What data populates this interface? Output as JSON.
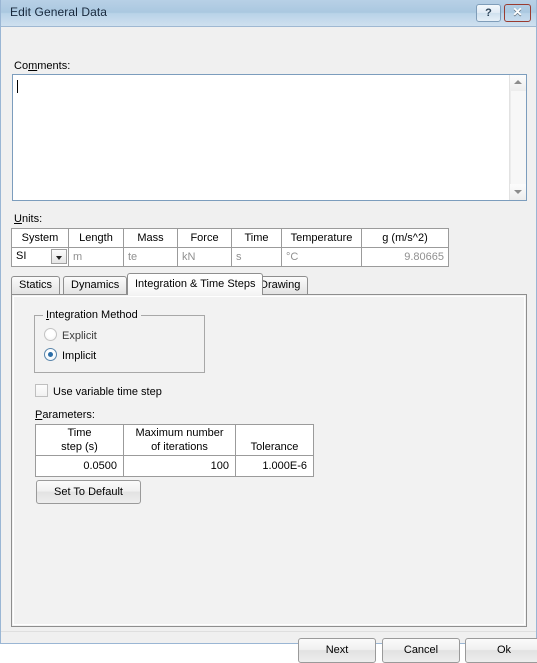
{
  "window": {
    "title": "Edit General Data",
    "help_button": "?",
    "close_button": "✕"
  },
  "comments": {
    "label": "Comments:",
    "label_prefix": "Co",
    "label_accel": "m",
    "label_suffix": "ments:",
    "value": "",
    "placeholder": "",
    "scroll_up": "▲",
    "scroll_down": "▼"
  },
  "units": {
    "label": "Units:",
    "label_accel": "U",
    "label_suffix": "nits:",
    "columns": [
      "System",
      "Length",
      "Mass",
      "Force",
      "Time",
      "Temperature",
      "g (m/s^2)"
    ],
    "values": {
      "system": "SI",
      "length": "m",
      "mass": "te",
      "force": "kN",
      "time": "s",
      "temperature": "°C",
      "gravity": "9.80665"
    },
    "system_options": [
      "SI"
    ]
  },
  "tabs": [
    {
      "label": "Statics",
      "active": false
    },
    {
      "label": "Dynamics",
      "active": false
    },
    {
      "label": "Integration & Time Steps",
      "active": true
    },
    {
      "label": "Drawing",
      "active": false
    }
  ],
  "integration_method": {
    "group_title": "Integration Method",
    "group_title_accel": "I",
    "group_title_suffix": "ntegration Method",
    "options": [
      {
        "label": "Explicit",
        "selected": false
      },
      {
        "label": "Implicit",
        "selected": true
      }
    ]
  },
  "variable_time_step": {
    "label": "Use variable time step",
    "checked": false
  },
  "parameters": {
    "label": "Parameters:",
    "label_accel": "P",
    "label_suffix": "arameters:",
    "columns": [
      {
        "line1": "Time",
        "line2": "step (s)"
      },
      {
        "line1": "Maximum number",
        "line2": "of iterations"
      },
      {
        "line1": "",
        "line2": "Tolerance"
      }
    ],
    "row": {
      "time_step": "0.0500",
      "max_iterations": "100",
      "tolerance": "1.000E-6"
    }
  },
  "actions": {
    "set_to_default": "Set To Default",
    "next": "Next",
    "cancel": "Cancel",
    "ok": "Ok"
  },
  "colors": {
    "titlebar_start": "#b8d0e6",
    "titlebar_end": "#cfe0ef",
    "dialog_background": "#f0f0f0",
    "close_button": "#c44d3f",
    "radio_accent": "#2b6ea8",
    "disabled_text": "#909090"
  }
}
